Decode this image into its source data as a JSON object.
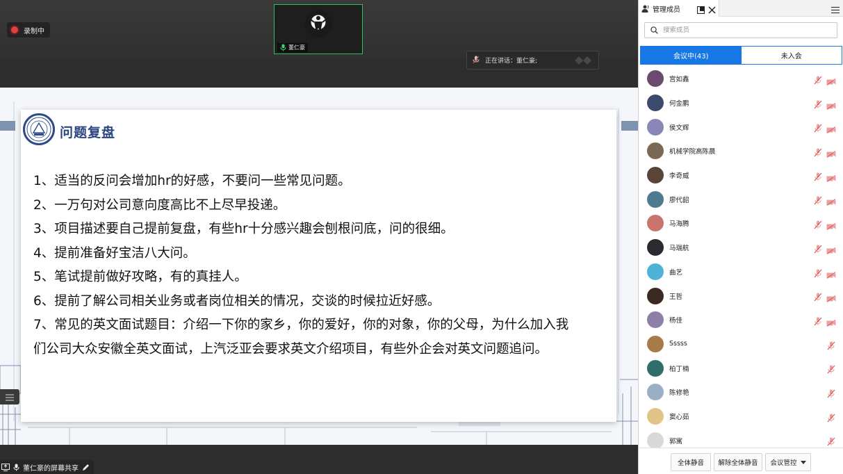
{
  "recording": {
    "label": "录制中",
    "color": "#e0403a"
  },
  "video_tile": {
    "name": "董仁豪",
    "border_color": "#2fbf6a"
  },
  "speaking": {
    "text": "正在讲话：董仁豪;"
  },
  "slide": {
    "title": "问题复盘",
    "points": [
      "1、适当的反问会增加hr的好感，不要问一些常见问题。",
      "2、一万句对公司意向度高比不上尽早投递。",
      "3、项目描述要自己提前复盘，有些hr十分感兴趣会刨根问底，问的很细。",
      "4、提前准备好宝洁八大问。",
      "5、笔试提前做好攻略，有的真挂人。",
      "6、提前了解公司相关业务或者岗位相关的情况，交谈的时候拉近好感。",
      "7、常见的英文面试题目：介绍一下你的家乡，你的爱好，你的对象，你的父母，为什么加入我",
      "们公司大众安徽全英文面试，上汽泛亚会要求英文介绍项目，有些外企会对英文问题追问。"
    ],
    "title_color": "#2b4582"
  },
  "share_bar": {
    "label": "董仁豪的屏幕共享"
  },
  "panel": {
    "title": "管理成员",
    "search_placeholder": "搜索成员",
    "tab_in_meeting": "会议中(43)",
    "tab_not_joined": "未入会",
    "accent": "#1677e5",
    "members": [
      {
        "name": "宫如鑫",
        "avatar": "#6a4a6e",
        "cam": true
      },
      {
        "name": "何金鹏",
        "avatar": "#3c4a6b",
        "cam": true
      },
      {
        "name": "侯文辉",
        "avatar": "#8a86b8",
        "cam": true
      },
      {
        "name": "机械学院高陈晨",
        "avatar": "#7a6a55",
        "cam": true
      },
      {
        "name": "李奇威",
        "avatar": "#5a4438",
        "cam": true
      },
      {
        "name": "廖代韶",
        "avatar": "#4f7b8e",
        "cam": true
      },
      {
        "name": "马海腾",
        "avatar": "#c9746e",
        "cam": true
      },
      {
        "name": "马瑞航",
        "avatar": "#2a2a30",
        "cam": true
      },
      {
        "name": "曲艺",
        "avatar": "#4fb3d8",
        "cam": true
      },
      {
        "name": "王哲",
        "avatar": "#3a2a22",
        "cam": true
      },
      {
        "name": "杨佳",
        "avatar": "#8e7fa8",
        "cam": true
      },
      {
        "name": "Sssss",
        "avatar": "#a87a4a",
        "cam": false
      },
      {
        "name": "柏丁楠",
        "avatar": "#2f6e6a",
        "cam": false
      },
      {
        "name": "陈修艳",
        "avatar": "#9ab0c8",
        "cam": false
      },
      {
        "name": "窦心茹",
        "avatar": "#e2c48a",
        "cam": false
      },
      {
        "name": "郭寓",
        "avatar": "#d9d9d9",
        "cam": false
      }
    ],
    "btn_mute_all": "全体静音",
    "btn_unmute_all": "解除全体静音",
    "btn_control": "会议管控"
  }
}
